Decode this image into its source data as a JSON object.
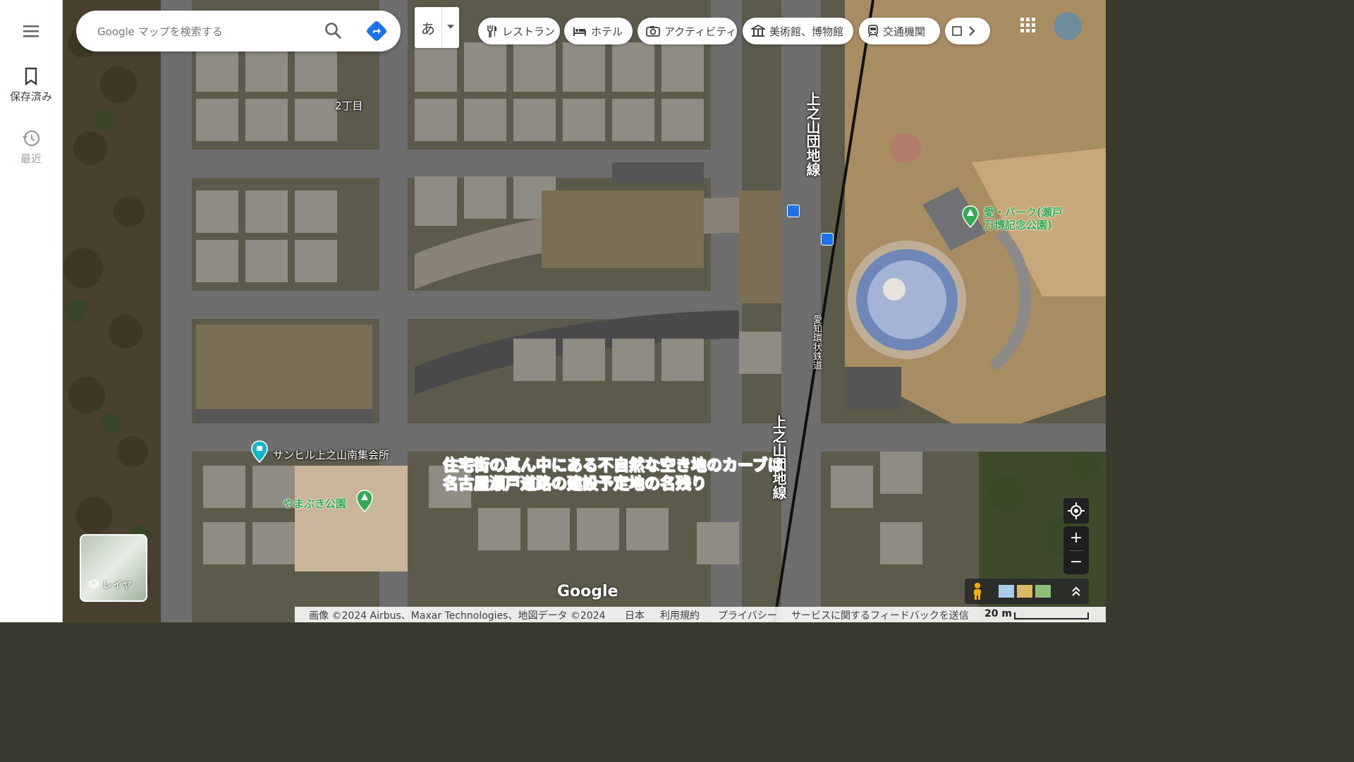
{
  "sidebar": {
    "menu_icon": "hamburger-icon",
    "items": [
      {
        "label": "保存済み",
        "icon": "bookmark-icon"
      },
      {
        "label": "最近",
        "icon": "history-icon"
      }
    ]
  },
  "search": {
    "placeholder": "Google マップを検索する",
    "value": ""
  },
  "input_method": {
    "char": "あ"
  },
  "categories": [
    {
      "label": "レストラン",
      "icon": "restaurant-icon"
    },
    {
      "label": "ホテル",
      "icon": "hotel-icon"
    },
    {
      "label": "アクティビティ",
      "icon": "camera-icon"
    },
    {
      "label": "美術館、博物館",
      "icon": "museum-icon"
    },
    {
      "label": "交通機関",
      "icon": "transit-icon"
    }
  ],
  "map": {
    "labels": {
      "area": "2丁目",
      "road_vertical": "上之山団地線",
      "road_vertical_2": "上之山団地線",
      "railway": "愛知環状鉄道",
      "community_hall": "サンヒル上之山南集会所",
      "park_small": "やまぶき公園",
      "park_large": "愛・パーク(瀬戸万博記念公園)"
    },
    "annotation": [
      "住宅街の真ん中にある不自然な空き地のカーブは",
      "名古屋瀬戸道路の建設予定地の名残り"
    ],
    "colors": {
      "annotation": "#ff3fa8",
      "park_label": "#34a853",
      "place_pin": "#12b5cb",
      "transit": "#1a73e8"
    }
  },
  "layers_button": {
    "label": "レイヤ"
  },
  "footer": {
    "logo": "Google",
    "attribution": "画像 ©2024 Airbus、Maxar Technologies、地図データ ©2024",
    "region": "日本",
    "terms": "利用規約",
    "privacy": "プライバシー",
    "feedback": "サービスに関するフィードバックを送信",
    "scale": "20 m"
  }
}
